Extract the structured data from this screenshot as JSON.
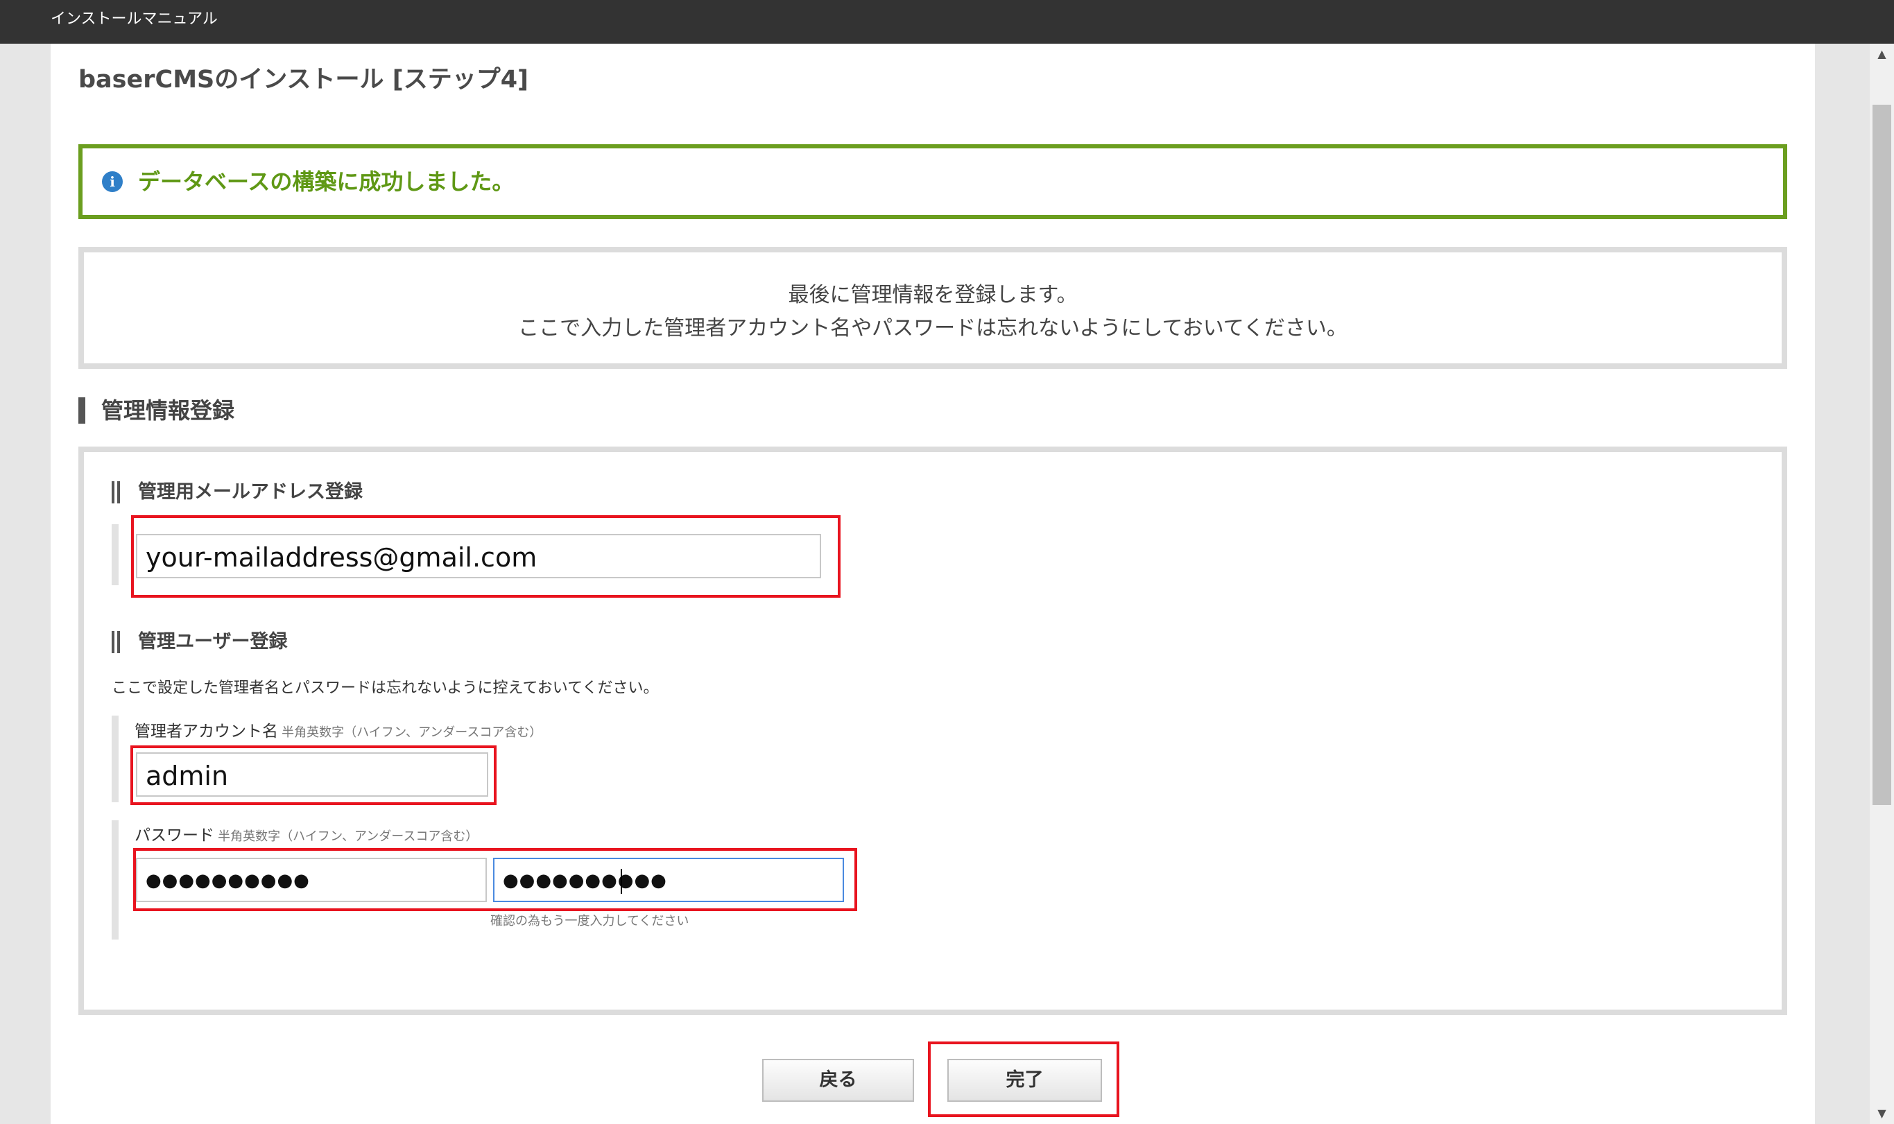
{
  "window": {
    "title": "インストールマニュアル"
  },
  "page": {
    "title": "baserCMSのインストール [ステップ4]"
  },
  "success": {
    "message": "データベースの構築に成功しました。"
  },
  "notice": {
    "line1": "最後に管理情報を登録します。",
    "line2": "ここで入力した管理者アカウント名やパスワードは忘れないようにしておいてください。"
  },
  "section": {
    "title": "管理情報登録"
  },
  "email_section": {
    "title": "管理用メールアドレス登録",
    "value": "your-mailaddress@gmail.com"
  },
  "user_section": {
    "title": "管理ユーザー登録",
    "description": "ここで設定した管理者名とパスワードは忘れないように控えておいてください。",
    "account": {
      "label": "管理者アカウント名",
      "hint": "半角英数字（ハイフン、アンダースコア含む）",
      "value": "admin"
    },
    "password": {
      "label": "パスワード",
      "hint": "半角英数字（ハイフン、アンダースコア含む）",
      "value": "●●●●●●●●●●",
      "confirm_value": "●●●●●●●●●●",
      "confirm_hint": "確認の為もう一度入力してください"
    }
  },
  "buttons": {
    "back": "戻る",
    "finish": "完了"
  },
  "icons": {
    "info": "info-icon",
    "scroll_up": "scroll-up-arrow-icon",
    "scroll_down": "scroll-down-arrow-icon"
  },
  "colors": {
    "topbar": "#333333",
    "success_border": "#6b9e1f",
    "success_text": "#5f9815",
    "highlight": "#e8141f",
    "focus": "#4a8adf"
  }
}
